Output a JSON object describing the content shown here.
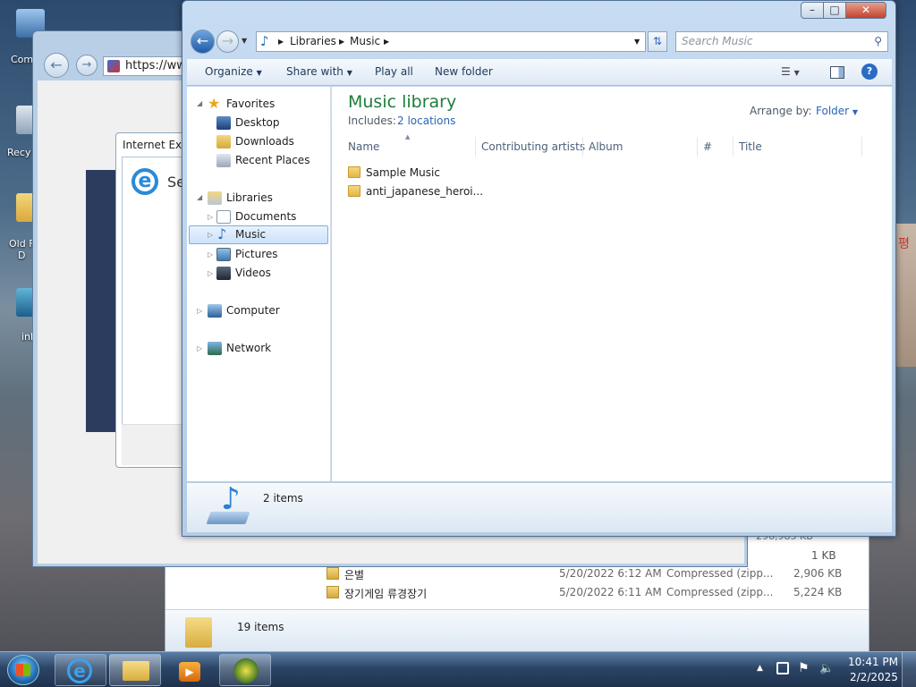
{
  "desktop": {
    "icons": [
      {
        "label": "Com"
      },
      {
        "label": "Recy"
      },
      {
        "label": "Old F\nD"
      },
      {
        "label": "inl"
      }
    ]
  },
  "ie_window": {
    "address": "https://www",
    "dialog_title": "Internet Expl",
    "dialog_text": "Se"
  },
  "bg_explorer": {
    "files": [
      {
        "size_top": "1 KB"
      },
      {
        "name": "은별",
        "date": "5/20/2022 6:12 AM",
        "type": "Compressed (zipp...",
        "size": "2,906 KB"
      },
      {
        "name": "장기게임 류경장기",
        "date": "5/20/2022 6:11 AM",
        "type": "Compressed (zipp...",
        "size": "5,224 KB"
      }
    ],
    "partial_size": "296,985 KB",
    "item_count": "19 items"
  },
  "explorer": {
    "breadcrumb": [
      "Libraries",
      "Music"
    ],
    "search_placeholder": "Search Music",
    "toolbar": {
      "organize": "Organize",
      "share_with": "Share with",
      "play_all": "Play all",
      "new_folder": "New folder"
    },
    "nav": {
      "favorites": "Favorites",
      "desktop": "Desktop",
      "downloads": "Downloads",
      "recent_places": "Recent Places",
      "libraries": "Libraries",
      "documents": "Documents",
      "music": "Music",
      "pictures": "Pictures",
      "videos": "Videos",
      "computer": "Computer",
      "network": "Network"
    },
    "library_title": "Music library",
    "includes_label": "Includes:",
    "includes_link": "2 locations",
    "arrange_by_label": "Arrange by:",
    "arrange_by_value": "Folder",
    "columns": [
      "Name",
      "Contributing artists",
      "Album",
      "#",
      "Title"
    ],
    "files": [
      {
        "name": "Sample Music"
      },
      {
        "name": "anti_japanese_heroi..."
      }
    ],
    "status": "2 items"
  },
  "taskbar": {
    "time": "10:41 PM",
    "date": "2/2/2025"
  }
}
